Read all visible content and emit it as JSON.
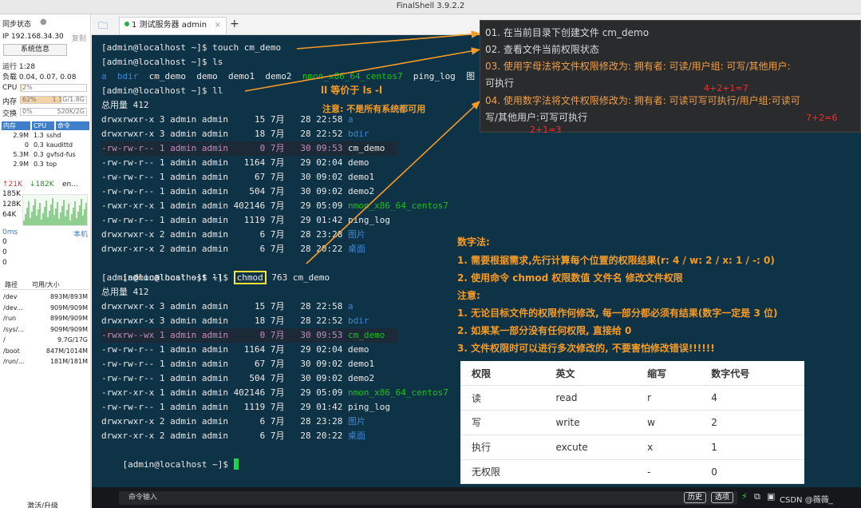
{
  "window": {
    "title": "FinalShell 3.9.2.2"
  },
  "sidebar": {
    "sync_status": "同步状态",
    "ip": "IP 192.168.34.30",
    "copy": "复制",
    "sysinfo_button": "系统信息",
    "uptime": "运行 1:28",
    "load": "负载 0.04, 0.07, 0.08",
    "cpu_label": "CPU",
    "cpu_value": "2%",
    "cpu_percent": 2,
    "mem_label": "内存",
    "mem_percent_text": "62%",
    "mem_value": "1.1G/1.8G",
    "mem_percent": 62,
    "swap_label": "交换",
    "swap_percent_text": "0%",
    "swap_value": "520K/2G",
    "swap_percent": 0,
    "proc_headers": [
      "内存",
      "CPU",
      "命令"
    ],
    "processes": [
      {
        "mem": "2.9M",
        "cpu": "1.3",
        "cmd": "sshd"
      },
      {
        "mem": "0",
        "cpu": "0.3",
        "cmd": "kaudittd"
      },
      {
        "mem": "5.3M",
        "cpu": "0.3",
        "cmd": "gvfsd-fus"
      },
      {
        "mem": "2.9M",
        "cpu": "0.3",
        "cmd": "top"
      }
    ],
    "net_up": "↑21K",
    "net_down": "↓182K",
    "net_iface": "en...",
    "net_scale": [
      "185K",
      "128K",
      "64K"
    ],
    "latency_label": "0ms",
    "latency_host": "本机",
    "latency_values": [
      "0",
      "0",
      "0"
    ],
    "disk_headers": [
      "路径",
      "可用/大小"
    ],
    "disks": [
      {
        "path": "/dev",
        "size": "893M/893M"
      },
      {
        "path": "/dev...",
        "size": "909M/909M"
      },
      {
        "path": "/run",
        "size": "899M/909M"
      },
      {
        "path": "/sys/...",
        "size": "909M/909M"
      },
      {
        "path": "/",
        "size": "9.7G/17G"
      },
      {
        "path": "/boot",
        "size": "847M/1014M"
      },
      {
        "path": "/run/...",
        "size": "181M/181M"
      }
    ],
    "upgrade": "激活/升级"
  },
  "tabs": {
    "active_label": "1 测试服务器 admin",
    "add": "+"
  },
  "terminal": {
    "cmd1": "[admin@localhost ~]$ touch cm_demo",
    "cmd2": "[admin@localhost ~]$ ls",
    "ls_items": [
      "a",
      "bdir",
      "cm_demo",
      "demo",
      "demo1",
      "demo2",
      "nmon_x86_64_centos7",
      "ping_log",
      "图"
    ],
    "cmd3": "[admin@localhost ~]$ ll",
    "total1": "总用量 412",
    "listing1": [
      {
        "perm": "drwxrwxr-x",
        "n": "3",
        "u": "admin",
        "g": "admin",
        "size": "15",
        "mon": "7月",
        "day": "28",
        "time": "22:58",
        "name": "a",
        "style": "blue"
      },
      {
        "perm": "drwxrwxr-x",
        "n": "3",
        "u": "admin",
        "g": "admin",
        "size": "18",
        "mon": "7月",
        "day": "28",
        "time": "22:52",
        "name": "bdir",
        "style": "blue"
      },
      {
        "perm": "-rw-rw-r--",
        "n": "1",
        "u": "admin",
        "g": "admin",
        "size": "0",
        "mon": "7月",
        "day": "30",
        "time": "09:53",
        "name": "cm_demo",
        "style": "hl-pink"
      },
      {
        "perm": "-rw-rw-r--",
        "n": "1",
        "u": "admin",
        "g": "admin",
        "size": "1164",
        "mon": "7月",
        "day": "29",
        "time": "02:04",
        "name": "demo",
        "style": "plain"
      },
      {
        "perm": "-rw-rw-r--",
        "n": "1",
        "u": "admin",
        "g": "admin",
        "size": "67",
        "mon": "7月",
        "day": "30",
        "time": "09:02",
        "name": "demo1",
        "style": "plain"
      },
      {
        "perm": "-rw-rw-r--",
        "n": "1",
        "u": "admin",
        "g": "admin",
        "size": "504",
        "mon": "7月",
        "day": "30",
        "time": "09:02",
        "name": "demo2",
        "style": "plain"
      },
      {
        "perm": "-rwxr-xr-x",
        "n": "1",
        "u": "admin",
        "g": "admin",
        "size": "402146",
        "mon": "7月",
        "day": "29",
        "time": "05:09",
        "name": "nmon_x86_64_centos7",
        "style": "green"
      },
      {
        "perm": "-rw-rw-r--",
        "n": "1",
        "u": "admin",
        "g": "admin",
        "size": "1119",
        "mon": "7月",
        "day": "29",
        "time": "01:42",
        "name": "ping_log",
        "style": "plain"
      },
      {
        "perm": "drwxrwxr-x",
        "n": "2",
        "u": "admin",
        "g": "admin",
        "size": "6",
        "mon": "7月",
        "day": "28",
        "time": "23:28",
        "name": "图片",
        "style": "blue"
      },
      {
        "perm": "drwxr-xr-x",
        "n": "2",
        "u": "admin",
        "g": "admin",
        "size": "6",
        "mon": "7月",
        "day": "28",
        "time": "20:22",
        "name": "桌面",
        "style": "blue"
      }
    ],
    "cmd4_prompt": "[admin@localhost ~]$",
    "cmd4_chmod": "chmod",
    "cmd4_rest": "763 cm_demo",
    "cmd5": "[admin@localhost ~]$ ll",
    "total2": "总用量 412",
    "listing2": [
      {
        "perm": "drwxrwxr-x",
        "n": "3",
        "u": "admin",
        "g": "admin",
        "size": "15",
        "mon": "7月",
        "day": "28",
        "time": "22:58",
        "name": "a",
        "style": "blue"
      },
      {
        "perm": "drwxrwxr-x",
        "n": "3",
        "u": "admin",
        "g": "admin",
        "size": "18",
        "mon": "7月",
        "day": "28",
        "time": "22:52",
        "name": "bdir",
        "style": "blue"
      },
      {
        "perm": "-rwxrw--wx",
        "n": "1",
        "u": "admin",
        "g": "admin",
        "size": "0",
        "mon": "7月",
        "day": "30",
        "time": "09:53",
        "name": "cm_demo",
        "style": "hl-green"
      },
      {
        "perm": "-rw-rw-r--",
        "n": "1",
        "u": "admin",
        "g": "admin",
        "size": "1164",
        "mon": "7月",
        "day": "29",
        "time": "02:04",
        "name": "demo",
        "style": "plain"
      },
      {
        "perm": "-rw-rw-r--",
        "n": "1",
        "u": "admin",
        "g": "admin",
        "size": "67",
        "mon": "7月",
        "day": "30",
        "time": "09:02",
        "name": "demo1",
        "style": "plain"
      },
      {
        "perm": "-rw-rw-r--",
        "n": "1",
        "u": "admin",
        "g": "admin",
        "size": "504",
        "mon": "7月",
        "day": "30",
        "time": "09:02",
        "name": "demo2",
        "style": "plain"
      },
      {
        "perm": "-rwxr-xr-x",
        "n": "1",
        "u": "admin",
        "g": "admin",
        "size": "402146",
        "mon": "7月",
        "day": "29",
        "time": "05:09",
        "name": "nmon_x86_64_centos7",
        "style": "green"
      },
      {
        "perm": "-rw-rw-r--",
        "n": "1",
        "u": "admin",
        "g": "admin",
        "size": "1119",
        "mon": "7月",
        "day": "29",
        "time": "01:42",
        "name": "ping_log",
        "style": "plain"
      },
      {
        "perm": "drwxrwxr-x",
        "n": "2",
        "u": "admin",
        "g": "admin",
        "size": "6",
        "mon": "7月",
        "day": "28",
        "time": "23:28",
        "name": "图片",
        "style": "blue"
      },
      {
        "perm": "drwxr-xr-x",
        "n": "2",
        "u": "admin",
        "g": "admin",
        "size": "6",
        "mon": "7月",
        "day": "28",
        "time": "20:22",
        "name": "桌面",
        "style": "blue"
      }
    ],
    "final_prompt": "[admin@localhost ~]$ "
  },
  "annotations": {
    "ll_equals": "ll 等价于 ls -l",
    "not_all_systems": "注意: 不是所有系统都可用",
    "panel": {
      "l1": "01. 在当前目录下创建文件 cm_demo",
      "l2": "02. 查看文件当前权限状态",
      "l3a": "03. 使用字母法将文件权限修改为: 拥有者: 可读/用户组: 可写/其他用户:",
      "l3b": "可执行",
      "l3_calc": "4+2+1=7",
      "l4a": "04. 使用数字法将文件权限修改为: 拥有者: 可读可写可执行/用户组:可读可",
      "l4b": "写/其他用户:可写可执行",
      "l4_calc1": "7+2=6",
      "l4_calc2": "2+1=3"
    },
    "numeric_method": {
      "title": "数字法:",
      "step1": "1. 需要根据需求,先行计算每个位置的权限结果(r: 4 / w: 2 / x: 1 / -: 0)",
      "step2": "2. 使用命令 chmod 权限数值 文件名 修改文件权限",
      "note_title": "注意:",
      "note1": "1. 无论目标文件的权限作何修改, 每一部分都必须有结果(数字一定是 3 位)",
      "note2": "2. 如果某一部分没有任何权限, 直接给 0",
      "note3": "3. 文件权限时可以进行多次修改的, 不要害怕修改错误!!!!!!"
    }
  },
  "perm_table": {
    "headers": [
      "权限",
      "英文",
      "缩写",
      "数字代号"
    ],
    "rows": [
      [
        "读",
        "read",
        "r",
        "4"
      ],
      [
        "写",
        "write",
        "w",
        "2"
      ],
      [
        "执行",
        "excute",
        "x",
        "1"
      ],
      [
        "无权限",
        "",
        "-",
        "0"
      ]
    ]
  },
  "cmdbar": {
    "input_placeholder": "命令输入",
    "history": "历史",
    "options": "选项",
    "watermark": "CSDN @薇薇_"
  },
  "colors": {
    "terminal_bg": "#0f3346",
    "annotation_orange": "#f59b26",
    "panel_bg": "#2a2b2d",
    "calc_red": "#ff2a2a"
  }
}
